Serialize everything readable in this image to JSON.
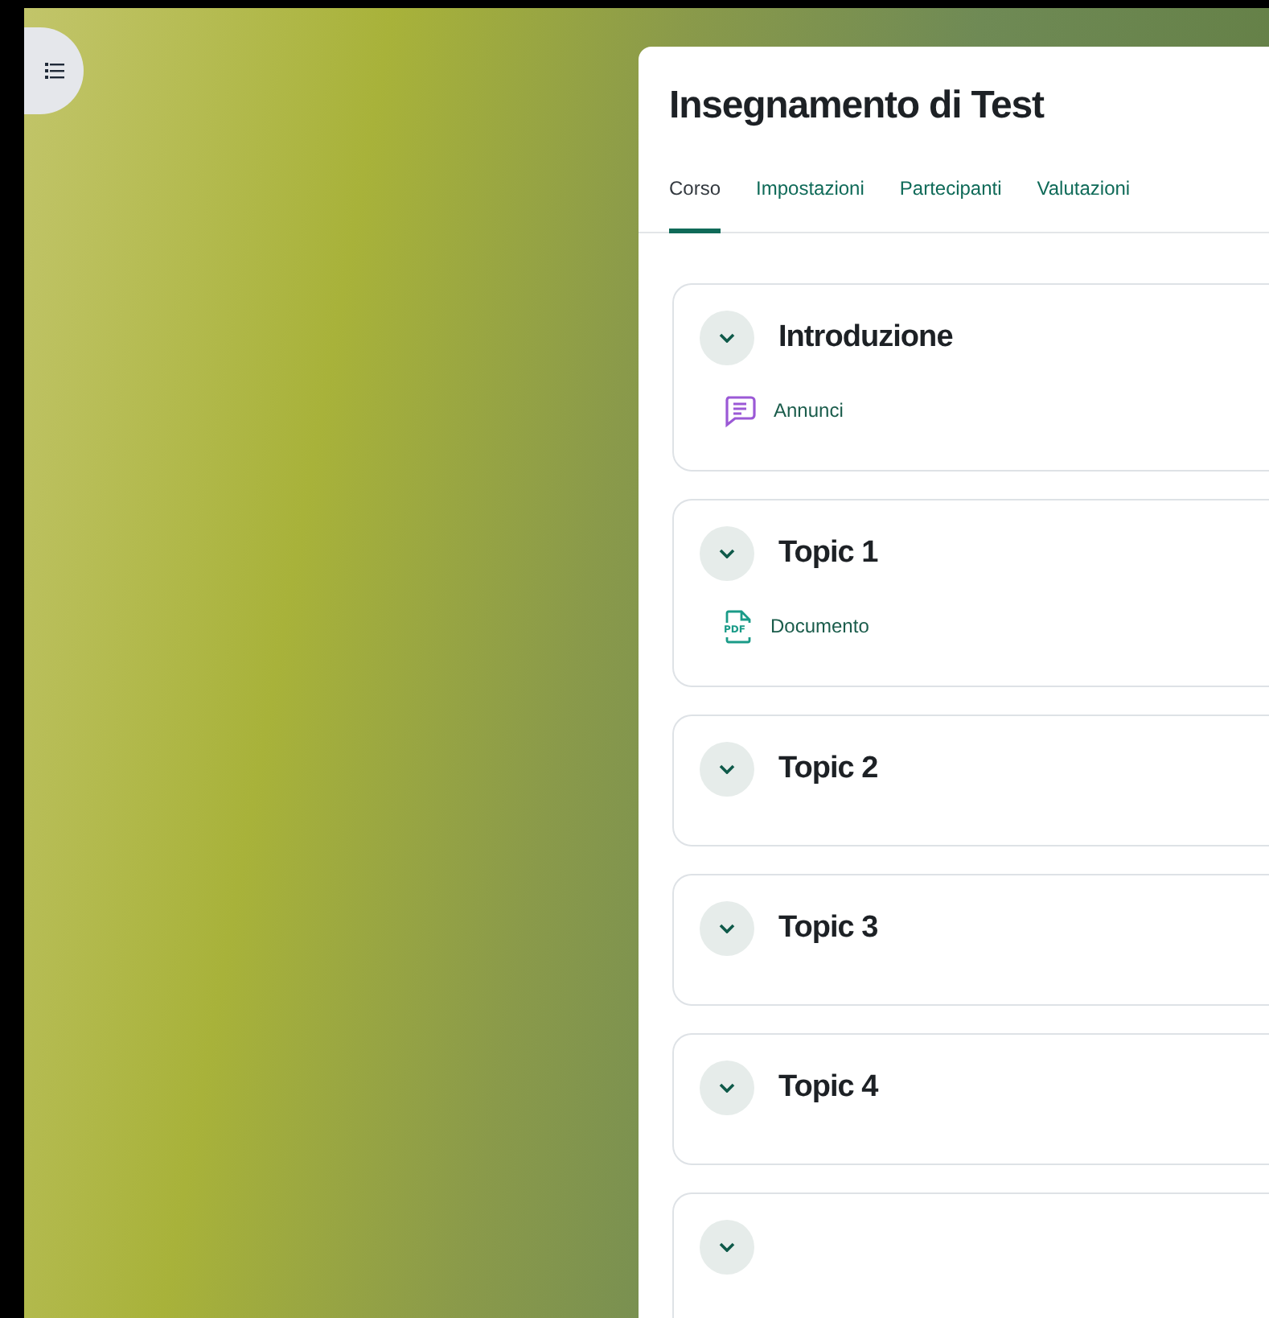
{
  "course": {
    "title": "Insegnamento di Test"
  },
  "tabs": [
    {
      "label": "Corso",
      "selected": true
    },
    {
      "label": "Impostazioni",
      "selected": false
    },
    {
      "label": "Partecipanti",
      "selected": false
    },
    {
      "label": "Valutazioni",
      "selected": false
    }
  ],
  "sections": [
    {
      "title": "Introduzione",
      "expanded": true,
      "activities": [
        {
          "kind": "forum",
          "label": "Annunci"
        }
      ]
    },
    {
      "title": "Topic 1",
      "expanded": true,
      "activities": [
        {
          "kind": "pdf",
          "icon_text": "PDF",
          "label": "Documento"
        }
      ]
    },
    {
      "title": "Topic 2",
      "expanded": true
    },
    {
      "title": "Topic 3",
      "expanded": true
    },
    {
      "title": "Topic 4",
      "expanded": true
    },
    {
      "expanded": true
    }
  ]
}
